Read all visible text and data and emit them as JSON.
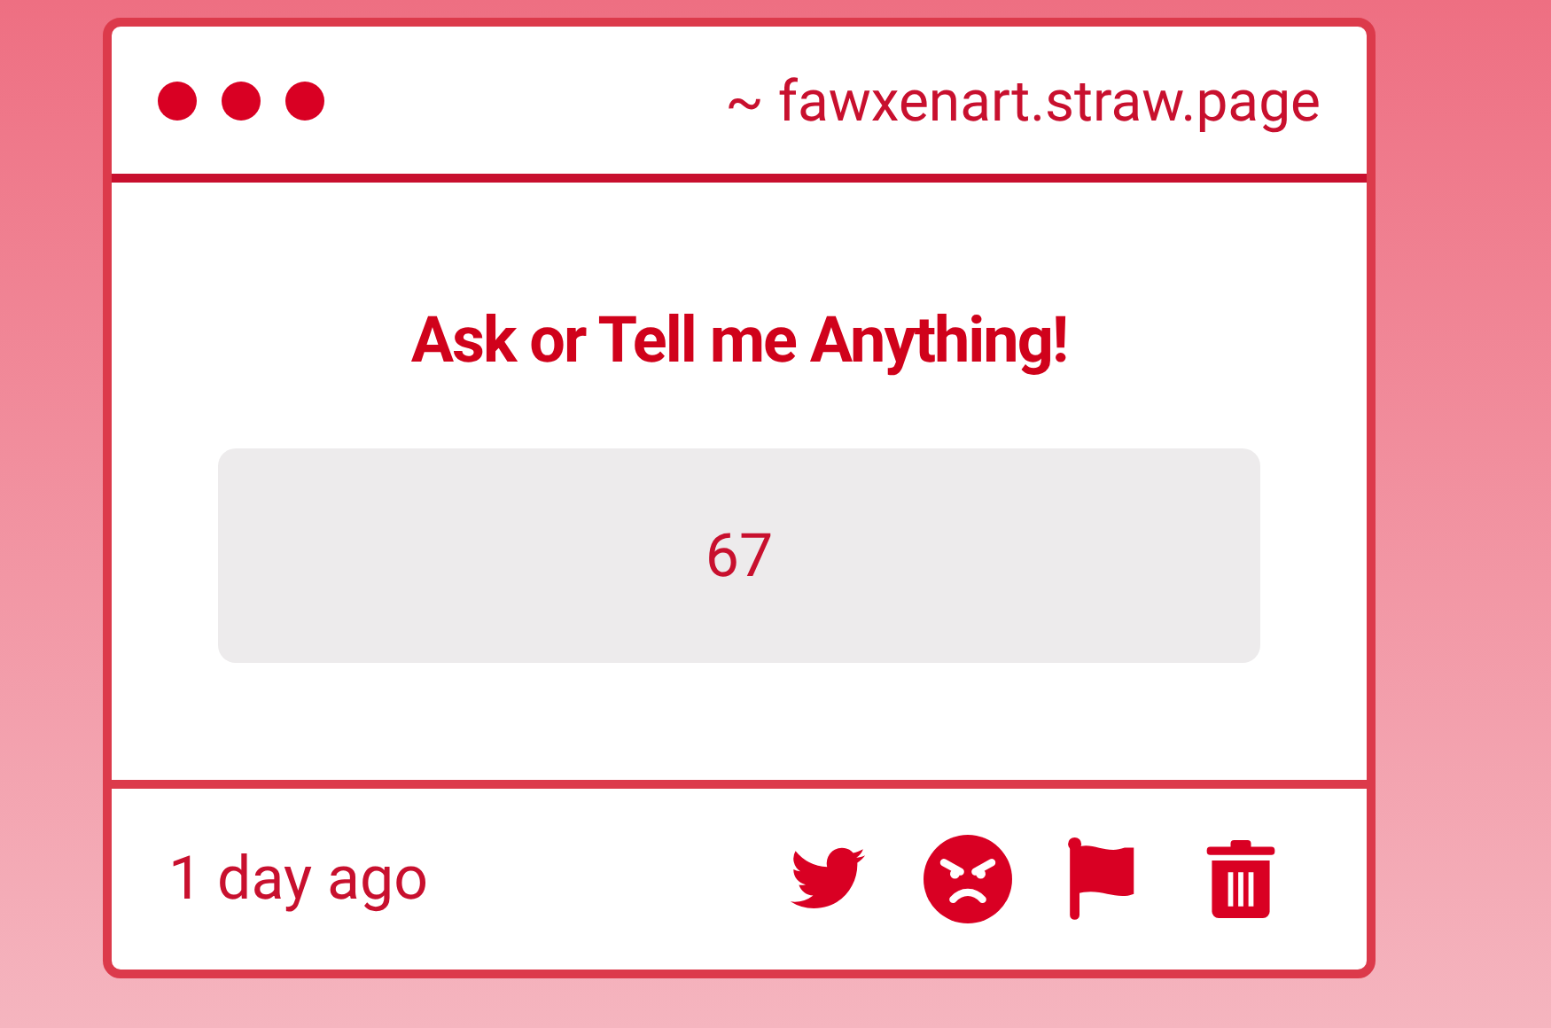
{
  "window": {
    "url": "~ fawxenart.straw.page"
  },
  "prompt": {
    "title": "Ask or Tell me Anything!",
    "message": "67"
  },
  "footer": {
    "time": "1 day ago",
    "actions": [
      {
        "kind": "bird"
      },
      {
        "kind": "angry"
      },
      {
        "kind": "flag"
      },
      {
        "kind": "trash"
      }
    ]
  }
}
